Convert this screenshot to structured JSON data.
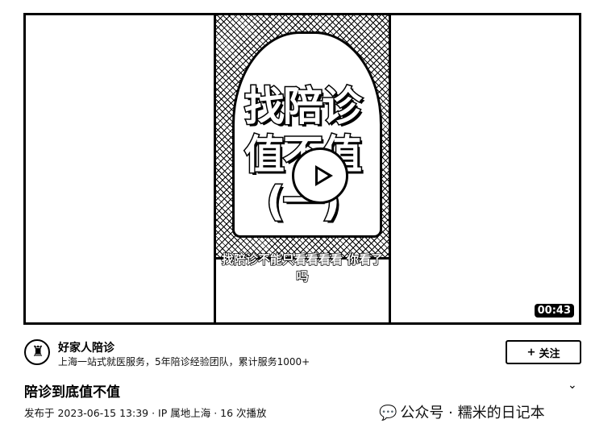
{
  "video": {
    "overlay_lines": [
      "找陪诊",
      "值不值",
      "(一)"
    ],
    "overlay_subtitle": "找陪诊不能只看看看看 你看了吗",
    "duration": "00:43",
    "play_icon": "play-icon"
  },
  "channel": {
    "name": "好家人陪诊",
    "description": "上海一站式就医服务，5年陪诊经验团队，累计服务1000+",
    "follow_label": "关注"
  },
  "post": {
    "title": "陪诊到底值不值",
    "meta": "发布于 2023-06-15 13:39 · IP 属地上海 · 16 次播放"
  },
  "watermark": "公众号 · 糯米的日记本"
}
